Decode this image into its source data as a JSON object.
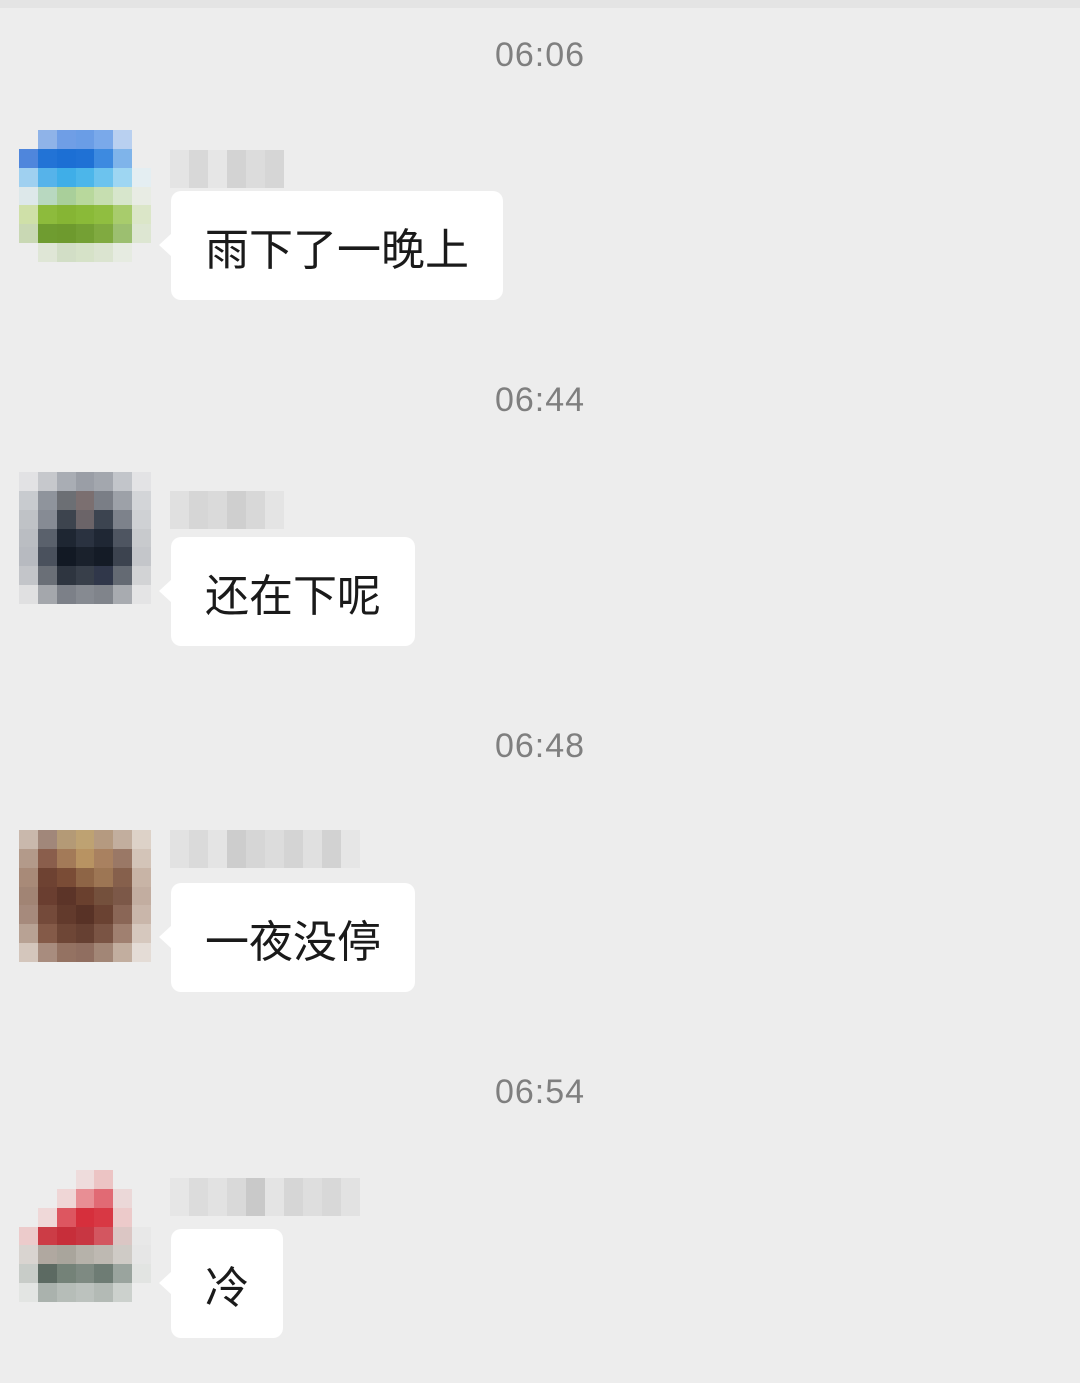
{
  "chat": {
    "messages": [
      {
        "time": "06:06",
        "text": "雨下了一晚上"
      },
      {
        "time": "06:44",
        "text": "还在下呢"
      },
      {
        "time": "06:48",
        "text": "一夜没停"
      },
      {
        "time": "06:54",
        "text": "冷"
      }
    ]
  },
  "colors": {
    "background": "#ededed",
    "bubble": "#ffffff",
    "timestamp_text": "#7f7f7f",
    "message_text": "#1a1a1a"
  },
  "icons": {
    "avatar": "pixelated-avatar-image",
    "sender_name": "pixelated-sender-name"
  }
}
